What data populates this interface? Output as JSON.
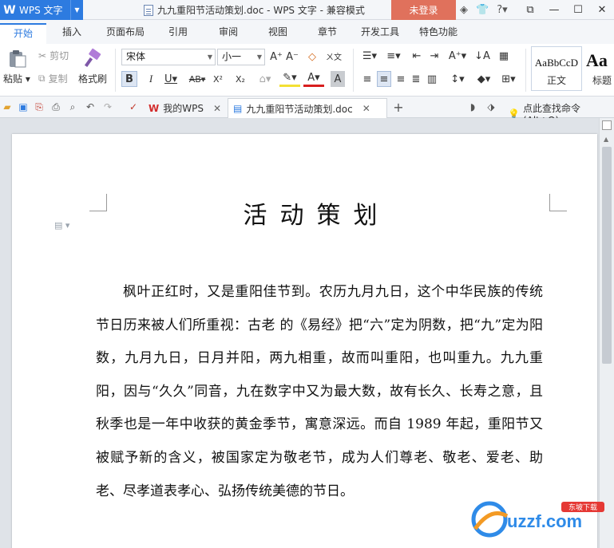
{
  "app": {
    "name": "WPS 文字",
    "logo": "W"
  },
  "window": {
    "title": "九九重阳节活动策划.doc - WPS 文字 - 兼容模式",
    "login_label": "未登录"
  },
  "menu": {
    "tabs": [
      "开始",
      "插入",
      "页面布局",
      "引用",
      "审阅",
      "视图",
      "章节",
      "开发工具",
      "特色功能"
    ]
  },
  "ribbon": {
    "paste_label": "粘贴",
    "cut_label": "剪切",
    "copy_label": "复制",
    "format_painter_label": "格式刷",
    "font_name": "宋体",
    "font_size": "小一",
    "styles": [
      {
        "sample": "AaBbCcD",
        "label": "正文"
      },
      {
        "sample": "Aa",
        "label": "标题"
      }
    ]
  },
  "doc_tabs": [
    {
      "label": "我的WPS"
    },
    {
      "label": "九九重阳节活动策划.doc"
    }
  ],
  "search_command": "点此查找命令 (Alt+Q)",
  "document": {
    "heading": "活动策划",
    "body": "枫叶正红时，又是重阳佳节到。农历九月九日，这个中华民族的传统节日历来被人们所重视：古老 的《易经》把“六”定为阴数，把“九”定为阳数，九月九日，日月并阳，两九相重，故而叫重阳，也叫重九。九九重阳，因与“久久”同音，九在数字中又为最大数，故有长久、长寿之意，且秋季也是一年中收获的黄金季节，寓意深远。而自 1989 年起，重阳节又被赋予新的含义，被国家定为敬老节，成为人们尊老、敬老、爱老、助老、尽孝道表孝心、弘扬传统美德的节日。"
  },
  "watermark": {
    "text": "uzzf.com",
    "subtext": "东坡下载"
  },
  "colors": {
    "accent": "#2d7be0",
    "login": "#e0715c"
  }
}
